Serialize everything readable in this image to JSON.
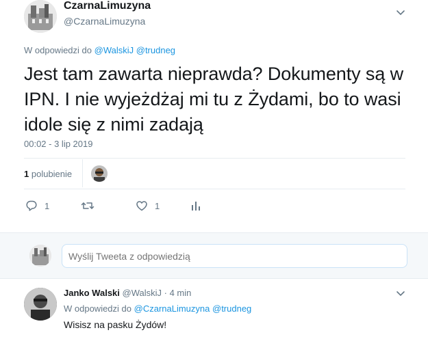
{
  "tweet": {
    "display_name": "CzarnaLimuzyna",
    "handle": "@CzarnaLimuzyna",
    "reply_prefix": "W odpowiedzi do",
    "reply_users": [
      "@WalskiJ",
      "@trudneg"
    ],
    "text": "Jest tam zawarta nieprawda?  Dokumenty są w IPN. I nie wyjeżdżaj mi tu z Żydami, bo to wasi idole się z nimi zadają",
    "timestamp": "00:02 - 3 lip 2019",
    "likes_count": "1",
    "likes_label": "polubienie"
  },
  "actions": {
    "reply_count": "1",
    "retweet_count": "",
    "like_count": "1"
  },
  "reply_box": {
    "placeholder": "Wyślij Tweeta z odpowiedzią"
  },
  "reply_tweet": {
    "display_name": "Janko Walski",
    "handle": "@WalskiJ",
    "time": "· 4 min",
    "reply_prefix": "W odpowiedzi do",
    "reply_users": [
      "@CzarnaLimuzyna",
      "@trudneg"
    ],
    "text": "Wisisz na pasku Żydów!"
  },
  "colors": {
    "link": "#1b95e0",
    "muted": "#657786",
    "text": "#14171a",
    "border": "#e6ecf0"
  }
}
